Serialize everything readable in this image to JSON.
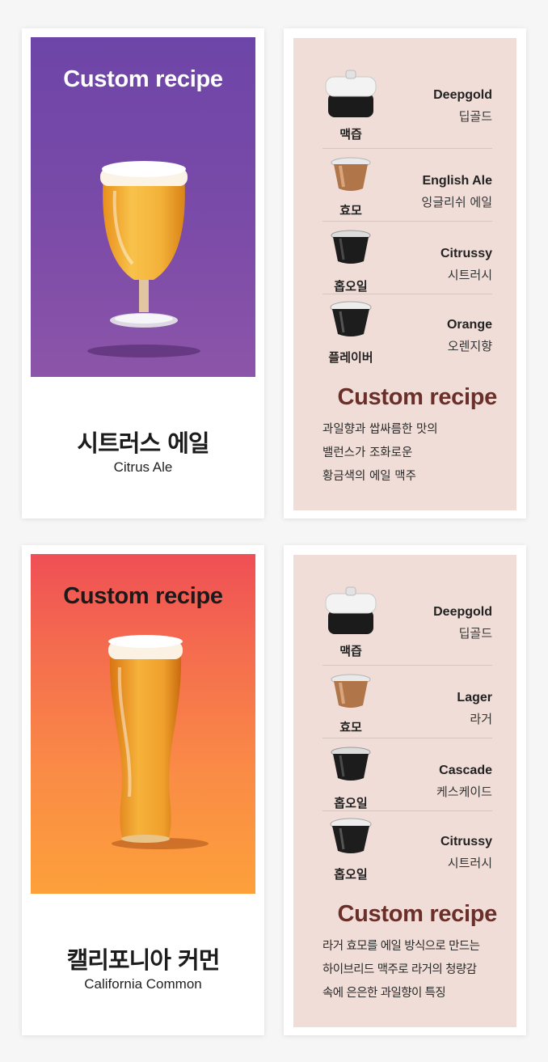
{
  "cards": [
    {
      "visual_title": "Custom recipe",
      "beer_name_ko": "시트러스 에일",
      "beer_name_en": "Citrus Ale",
      "ingredients": [
        {
          "label": "맥즙",
          "name_en": "Deepgold",
          "name_ko": "딥골드",
          "capsule": "white-lid-capsule"
        },
        {
          "label": "효모",
          "name_en": "English Ale",
          "name_ko": "잉글리쉬 에일",
          "capsule": "bronze-capsule"
        },
        {
          "label": "홉오일",
          "name_en": "Citrussy",
          "name_ko": "시트러시",
          "capsule": "black-capsule"
        },
        {
          "label": "플레이버",
          "name_en": "Orange",
          "name_ko": "오렌지향",
          "capsule": "black-silver-capsule"
        }
      ],
      "recipe_title": "Custom recipe",
      "description": [
        "과일향과 쌉싸름한 맛의",
        "밸런스가 조화로운",
        "황금색의 에일 맥주"
      ]
    },
    {
      "visual_title": "Custom recipe",
      "beer_name_ko": "캘리포니아 커먼",
      "beer_name_en": "California Common",
      "ingredients": [
        {
          "label": "맥즙",
          "name_en": "Deepgold",
          "name_ko": "딥골드",
          "capsule": "white-lid-capsule"
        },
        {
          "label": "효모",
          "name_en": "Lager",
          "name_ko": "라거",
          "capsule": "bronze-capsule"
        },
        {
          "label": "홉오일",
          "name_en": "Cascade",
          "name_ko": "케스케이드",
          "capsule": "black-capsule"
        },
        {
          "label": "홉오일",
          "name_en": "Citrussy",
          "name_ko": "시트러시",
          "capsule": "black-silver-capsule"
        }
      ],
      "recipe_title": "Custom recipe",
      "description": [
        "라거 효모를 에일 방식으로 만드는",
        "하이브리드 맥주로 라거의 청량감",
        "속에 은은한 과일향이 특징"
      ]
    }
  ],
  "colors": {
    "purple_bg": "#7449a8",
    "orange_bg": "#f7793f",
    "recipe_panel": "#f0ddd7",
    "recipe_title": "#6b2f2a"
  }
}
